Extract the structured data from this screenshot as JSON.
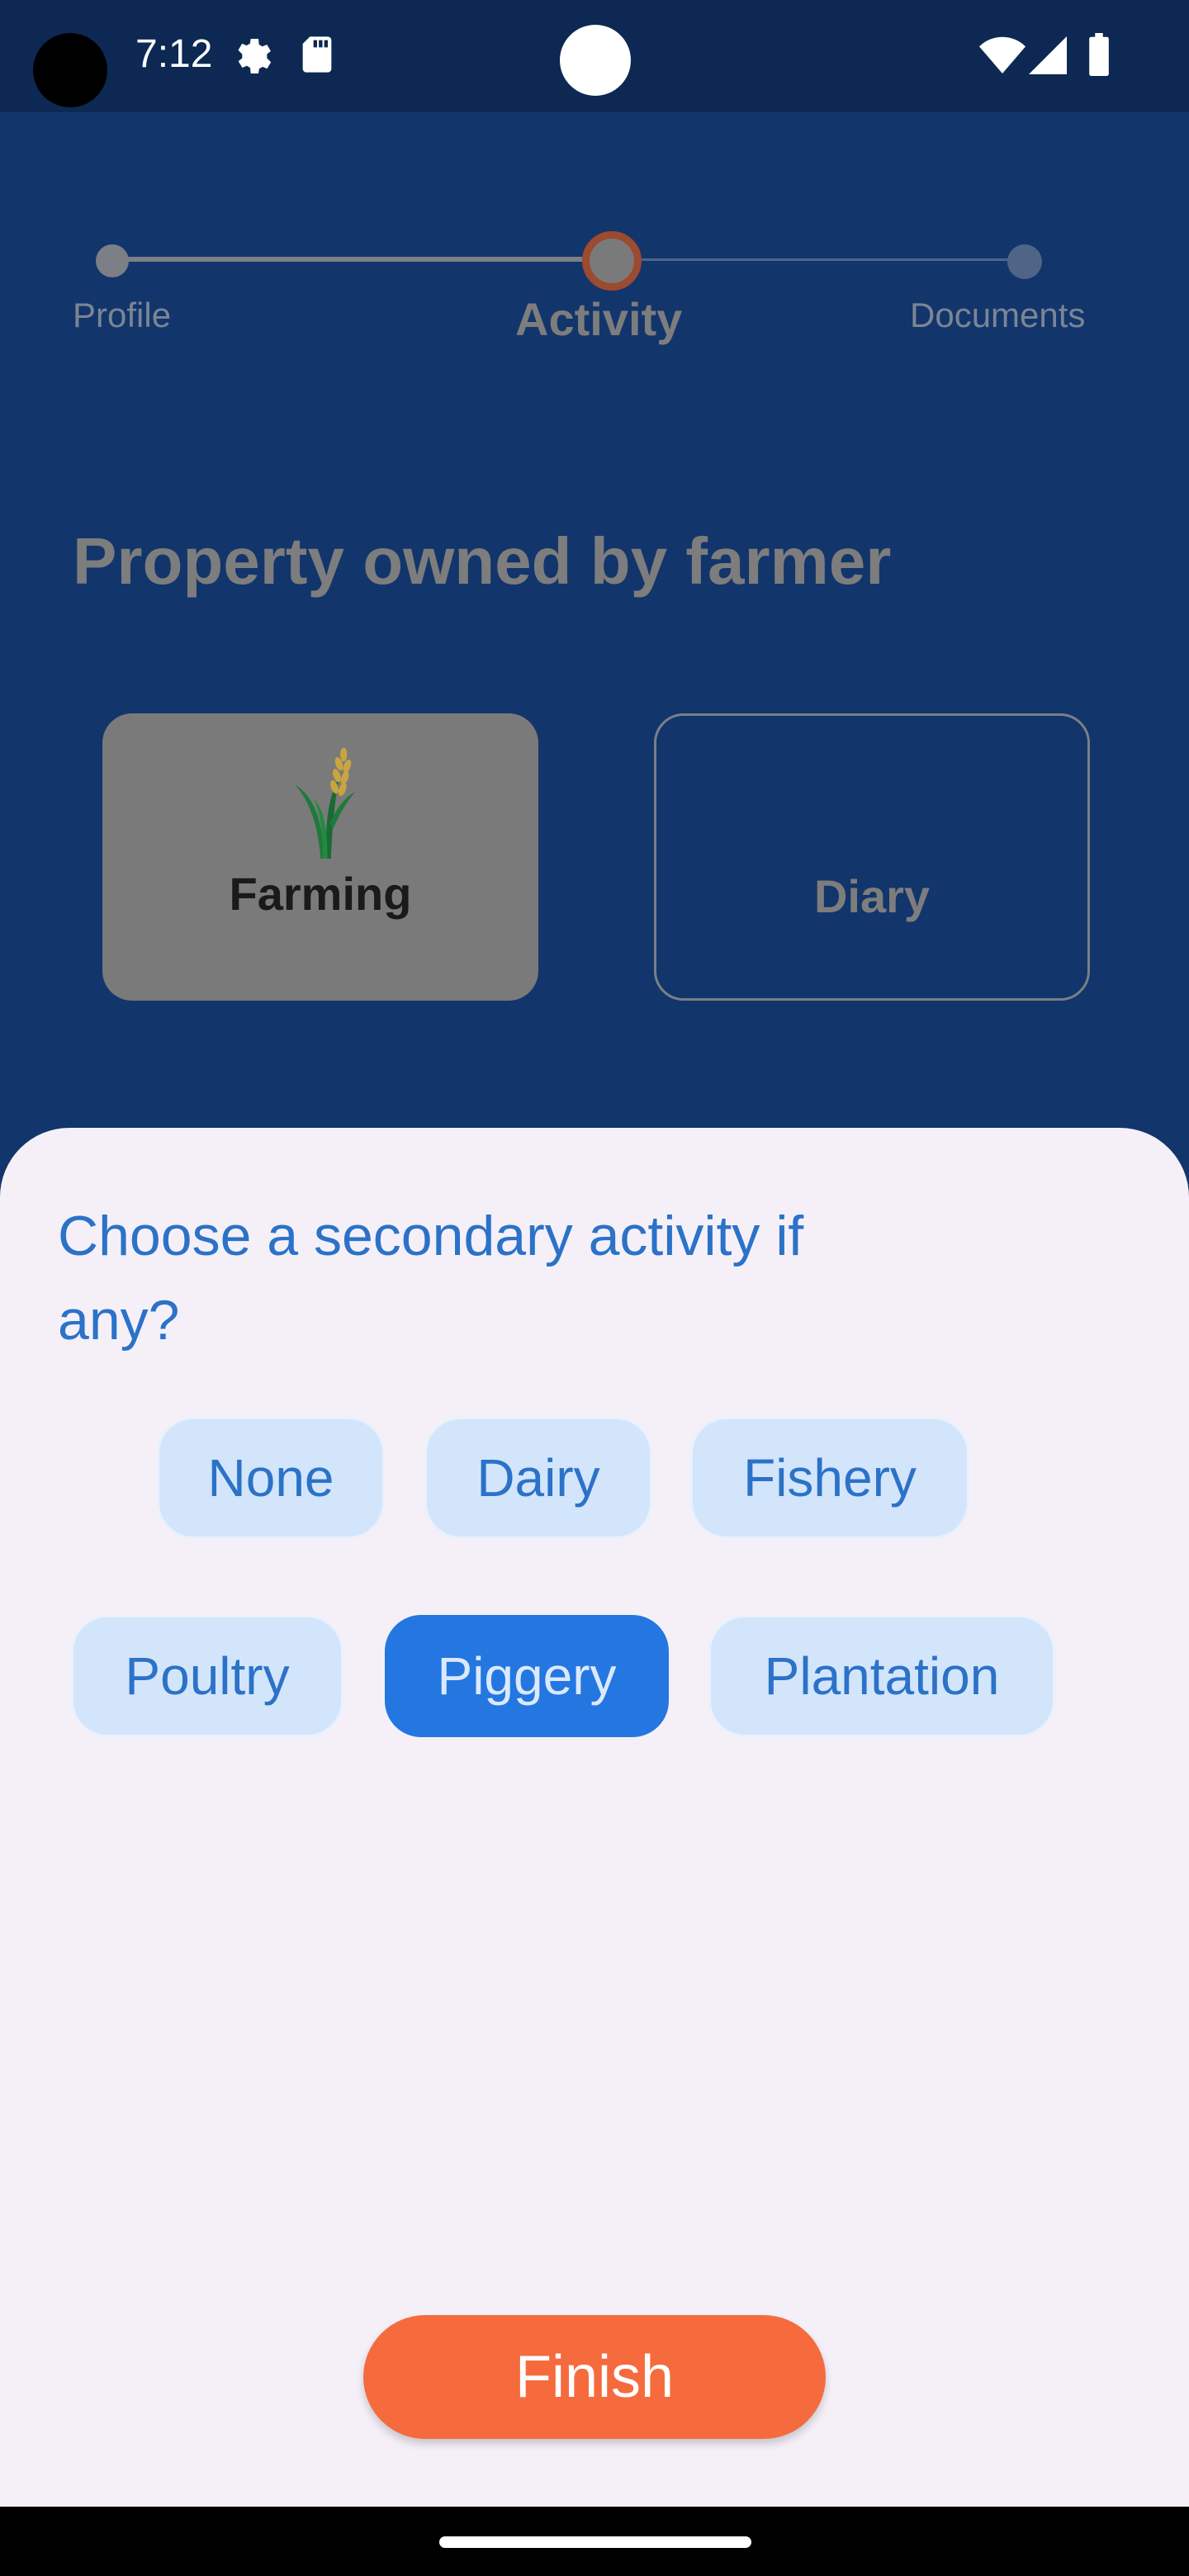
{
  "status_bar": {
    "time": "7:12",
    "icons": [
      "settings-gear-icon",
      "sd-card-icon",
      "wifi-icon",
      "cellular-signal-icon",
      "battery-icon"
    ]
  },
  "stepper": {
    "steps": [
      {
        "label": "Profile",
        "state": "completed"
      },
      {
        "label": "Activity",
        "state": "current"
      },
      {
        "label": "Documents",
        "state": "upcoming"
      }
    ]
  },
  "page": {
    "title": "Property owned by farmer",
    "cards": [
      {
        "label": "Farming",
        "selected": true,
        "icon": "wheat-plant-icon"
      },
      {
        "label": "Diary",
        "selected": false
      }
    ]
  },
  "sheet": {
    "title": "Choose a secondary activity if any?",
    "options": [
      {
        "label": "None",
        "selected": false
      },
      {
        "label": "Dairy",
        "selected": false
      },
      {
        "label": "Fishery",
        "selected": false
      },
      {
        "label": "Poultry",
        "selected": false
      },
      {
        "label": "Piggery",
        "selected": true
      },
      {
        "label": "Plantation",
        "selected": false
      }
    ],
    "finish_label": "Finish"
  },
  "colors": {
    "background": "#12356b",
    "accent": "#2477e0",
    "finish": "#f56b3d",
    "sheet": "#f5f0f8"
  }
}
